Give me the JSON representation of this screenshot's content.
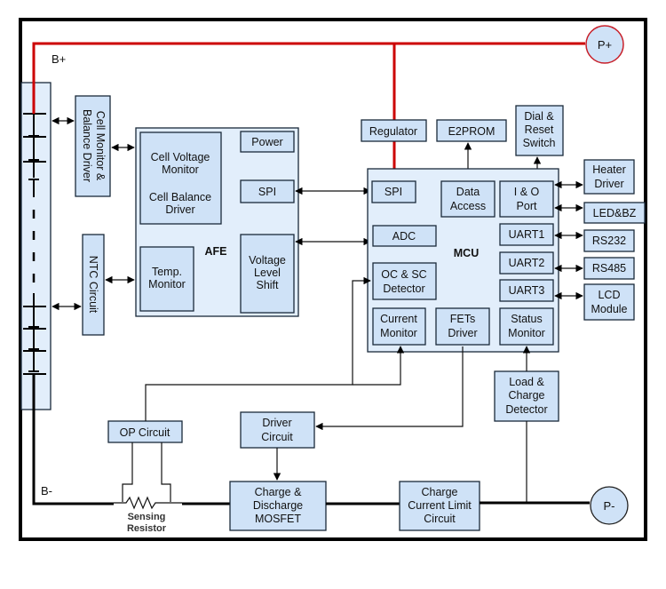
{
  "labels": {
    "b_plus": "B+",
    "b_minus": "B-",
    "p_plus": "P+",
    "p_minus": "P-"
  },
  "blocks": {
    "cell_monitor": [
      "Cell Monitor &",
      "Balance Driver"
    ],
    "ntc": "NTC Circuit",
    "afe": {
      "title": "AFE",
      "cell_voltage": [
        "Cell Voltage",
        "Monitor",
        "",
        "Cell Balance",
        "Driver"
      ],
      "power": "Power",
      "spi": "SPI",
      "temp": [
        "Temp.",
        "Monitor"
      ],
      "vls": [
        "Voltage",
        "Level",
        "Shift"
      ]
    },
    "regulator": "Regulator",
    "e2prom": "E2PROM",
    "dial": [
      "Dial &",
      "Reset",
      "Switch"
    ],
    "mcu": {
      "title": "MCU",
      "spi": "SPI",
      "data_access": [
        "Data",
        "Access"
      ],
      "io_port": [
        "I & O",
        "Port"
      ],
      "adc": "ADC",
      "uart1": "UART1",
      "uart2": "UART2",
      "uart3": "UART3",
      "ocsc": [
        "OC & SC",
        "Detector"
      ],
      "current_monitor": [
        "Current",
        "Monitor"
      ],
      "fets_driver": [
        "FETs",
        "Driver"
      ],
      "status_monitor": [
        "Status",
        "Monitor"
      ]
    },
    "heater": [
      "Heater",
      "Driver"
    ],
    "ledbz": "LED&BZ",
    "rs232": "RS232",
    "rs485": "RS485",
    "lcd": [
      "LCD",
      "Module"
    ],
    "load_charge": [
      "Load &",
      "Charge",
      "Detector"
    ],
    "op_circuit": "OP Circuit",
    "driver_circuit": [
      "Driver",
      "Circuit"
    ],
    "mosfet": [
      "Charge &",
      "Discharge",
      "MOSFET"
    ],
    "charge_limit": [
      "Charge",
      "Current Limit",
      "Circuit"
    ],
    "sensing_resistor": [
      "Sensing",
      "Resistor"
    ]
  }
}
